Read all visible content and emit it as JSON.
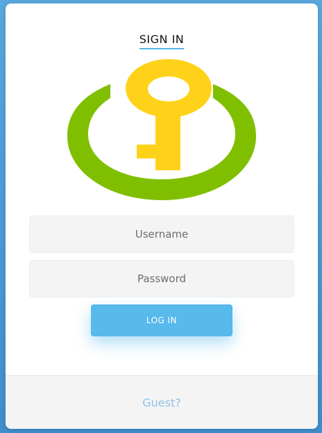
{
  "header": {
    "title": "SIGN IN"
  },
  "logo": {
    "icon": "key-in-circle-icon",
    "colors": {
      "ring": "#7fbf00",
      "key": "#ffd21a"
    }
  },
  "form": {
    "username_placeholder": "Username",
    "password_placeholder": "Password",
    "login_label": "LOG IN"
  },
  "footer": {
    "guest_label": "Guest?"
  },
  "colors": {
    "accent": "#57b9ec",
    "background": "#4a9ad6",
    "guest_text": "#8ec2e6"
  }
}
